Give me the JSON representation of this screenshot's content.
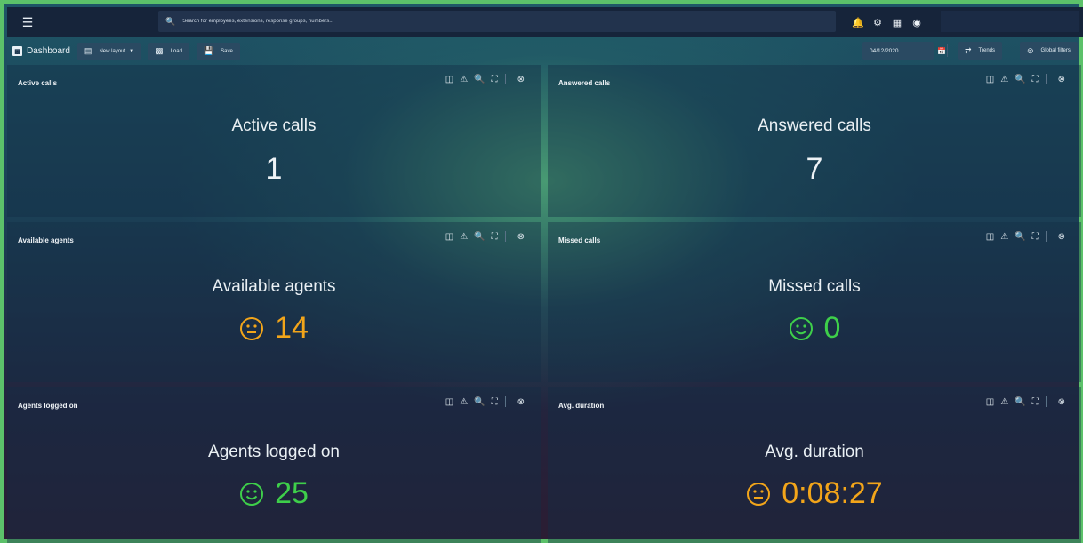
{
  "topbar": {
    "search_placeholder": "Search for employees, extensions, response groups, numbers..."
  },
  "toolbar": {
    "dashboard_label": "Dashboard",
    "new_layout_label": "New layout",
    "load_label": "Load",
    "save_label": "Save",
    "date_value": "04/12/2020",
    "trends_label": "Trends",
    "global_filters_label": "Global filters"
  },
  "colors": {
    "neutral": "#eef3f6",
    "warning": "#f2a51a",
    "good": "#3ecf4a"
  },
  "panels": [
    {
      "title": "Active calls",
      "label": "Active calls",
      "value": "1",
      "status": "none"
    },
    {
      "title": "Answered calls",
      "label": "Answered calls",
      "value": "7",
      "status": "none"
    },
    {
      "title": "Available agents",
      "label": "Available agents",
      "value": "14",
      "status": "neutral-face"
    },
    {
      "title": "Missed calls",
      "label": "Missed calls",
      "value": "0",
      "status": "happy-face"
    },
    {
      "title": "Agents logged on",
      "label": "Agents logged on",
      "value": "25",
      "status": "happy-face"
    },
    {
      "title": "Avg. duration",
      "label": "Avg. duration",
      "value": "0:08:27",
      "status": "neutral-face"
    }
  ]
}
